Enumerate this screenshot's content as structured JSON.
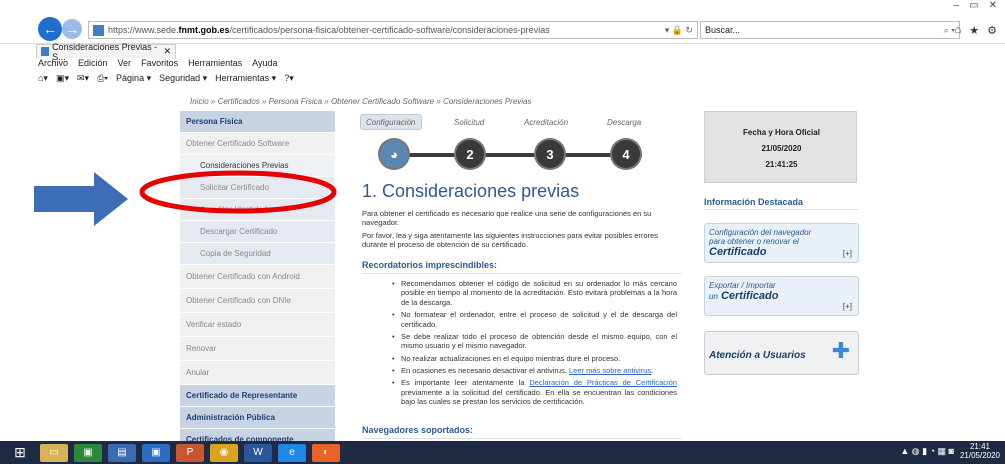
{
  "window": {
    "min": "–",
    "max": "▭",
    "close": "✕"
  },
  "browser": {
    "url_prefix": "https://www.sede.",
    "url_host": "fnmt.gob.es",
    "url_path": "/certificados/persona-fisica/obtener-certificado-software/consideraciones-previas",
    "url_tail": "▾ 🔒 ↻",
    "search_text": "Buscar...",
    "tab_title": "Consideraciones Previas - S...",
    "tab_close": "✕"
  },
  "menu": [
    "Archivo",
    "Edición",
    "Ver",
    "Favoritos",
    "Herramientas",
    "Ayuda"
  ],
  "cmdbar": [
    "Página ▾",
    "Seguridad ▾",
    "Herramientas ▾"
  ],
  "breadcrumb": "Inicio  »  Certificados  »  Persona Física  »  Obtener Certificado Software  »      Consideraciones Previas",
  "sidebar": [
    {
      "label": "Persona Física"
    },
    {
      "label": "Obtener Certificado Software"
    },
    {
      "label": "Consideraciones Previas"
    },
    {
      "label": "Solicitar Certificado"
    },
    {
      "label": "Acreditar Identidad"
    },
    {
      "label": "Descargar Certificado"
    },
    {
      "label": "Copia de Seguridad"
    },
    {
      "label": "Obtener Certificado con Android"
    },
    {
      "label": "Obtener Certificado con DNIe"
    },
    {
      "label": "Verificar estado"
    },
    {
      "label": "Renovar"
    },
    {
      "label": "Anular"
    },
    {
      "label": "Certificado de Representante"
    },
    {
      "label": "Administración Pública"
    },
    {
      "label": "Certificados de componente"
    }
  ],
  "steps": {
    "labels": [
      "Configuración",
      "Solicitud",
      "Acreditación",
      "Descarga"
    ],
    "numbers": [
      "2",
      "3",
      "4"
    ]
  },
  "main": {
    "title": "1. Consideraciones previas",
    "p1": "Para obtener el certificado es necesario que realice una serie de configuraciones en su navegador.",
    "p2": "Por favor, lea y siga atentamente las siguientes instrucciones para evitar posibles errores durante el proceso de obtención de su certificado.",
    "reminders_title": "Recordatorios imprescindibles:",
    "bullet1": "Recomendamos obtener el código de solicitud en su ordenador lo más cercano posible en tiempo al momento de la acreditación. Esto evitará problemas a la hora de la descarga.",
    "bullet2": "No formatear el ordenador, entre el proceso de solicitud y el de descarga del certificado.",
    "bullet3": "Se debe realizar todo el proceso de obtención desde el mismo equipo, con el mismo usuario y el mismo navegador.",
    "bullet4": "No realizar actualizaciones en el equipo mientras dure el proceso.",
    "bullet5a": "En ocasiones es necesario desactivar el antivirus.",
    "bullet5b": "Leer más sobre antivirus",
    "bullet5c": ".",
    "bullet6a": "Es importante leer atentamente la",
    "bullet6b": "Declaración de Prácticas de Certificación",
    "bullet6c": "previamente a la solicitud del certificado. En ella se encuentran las condiciones bajo las cuales se prestan los servicios de certificación.",
    "browsers_title": "Navegadores soportados:"
  },
  "right": {
    "date_title": "Fecha y Hora Oficial",
    "date": "21/05/2020",
    "time": "21:41:25",
    "info_title": "Información Destacada",
    "card1_line1": "Configuración del navegador",
    "card1_line2": "para obtener o renovar el",
    "card1_bold": "Certificado",
    "card2_line1": "Exportar / Importar",
    "card2_line2": "un",
    "card2_bold": "Certificado",
    "card3": "Atención a Usuarios",
    "plus": "[+]"
  },
  "taskbar": {
    "time": "21:41",
    "date": "21/05/2020"
  },
  "colors": {
    "accent": "#2e5b8f",
    "arrow": "#3d6db5",
    "highlight_ring": "#e60000"
  }
}
